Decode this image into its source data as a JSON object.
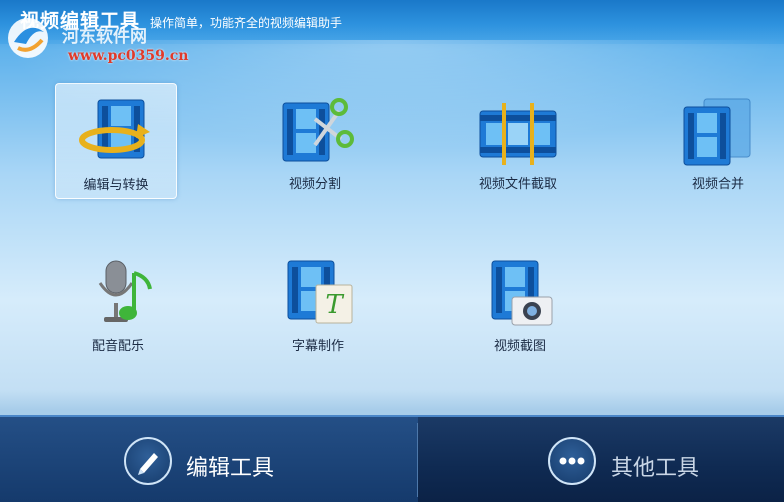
{
  "window": {
    "title": "视频编辑工具",
    "subtitle": "操作简单，功能齐全的视频编辑助手",
    "watermark_url": "www.pc0359.cn",
    "watermark_site": "河东软件网"
  },
  "tools": [
    {
      "label": "编辑与转换",
      "icon": "edit-convert-icon",
      "selected": true
    },
    {
      "label": "视频分割",
      "icon": "video-split-icon",
      "selected": false
    },
    {
      "label": "视频文件截取",
      "icon": "video-clip-icon",
      "selected": false
    },
    {
      "label": "视频合并",
      "icon": "video-merge-icon",
      "selected": false
    },
    {
      "label": "配音配乐",
      "icon": "dub-music-icon",
      "selected": false
    },
    {
      "label": "字幕制作",
      "icon": "subtitle-icon",
      "selected": false
    },
    {
      "label": "视频截图",
      "icon": "video-screenshot-icon",
      "selected": false
    }
  ],
  "bottom_tabs": {
    "edit_tools": "编辑工具",
    "other_tools": "其他工具"
  },
  "colors": {
    "film_blue": "#1e7ad6",
    "bottom_bar": "#0f2a52",
    "watermark_red": "#e03a2a"
  }
}
